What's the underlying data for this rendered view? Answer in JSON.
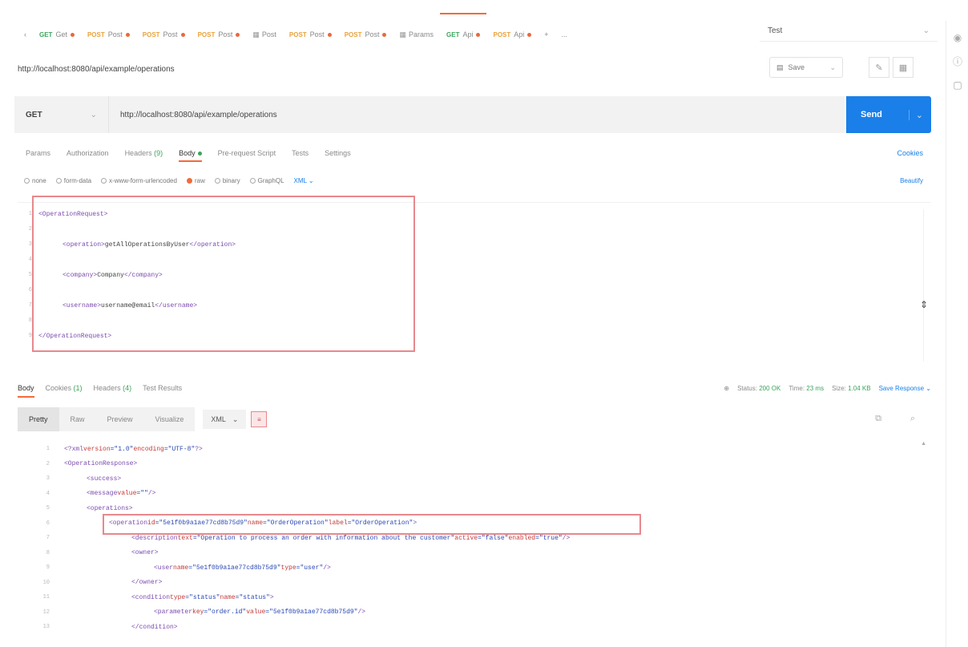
{
  "tabs": [
    {
      "method": "GET",
      "label": "Get",
      "modified": true
    },
    {
      "method": "POST",
      "label": "Post",
      "modified": true
    },
    {
      "method": "POST",
      "label": "Post",
      "modified": true
    },
    {
      "method": "POST",
      "label": "Post",
      "modified": true
    },
    {
      "method": "",
      "label": "Post",
      "modified": false,
      "icon": "grid"
    },
    {
      "method": "POST",
      "label": "Post",
      "modified": true
    },
    {
      "method": "POST",
      "label": "Post",
      "modified": true
    },
    {
      "method": "",
      "label": "Params",
      "modified": false,
      "icon": "grid"
    },
    {
      "method": "GET",
      "label": "Api",
      "modified": true,
      "active": true
    },
    {
      "method": "POST",
      "label": "Api",
      "modified": true
    }
  ],
  "tab_controls": [
    "+",
    "..."
  ],
  "environment": {
    "label": "Test"
  },
  "request": {
    "name": "http://localhost:8080/api/example/operations",
    "method": "GET",
    "url": "http://localhost:8080/api/example/operations",
    "save_label": "Save",
    "send_label": "Send"
  },
  "request_tabs": {
    "params": "Params",
    "authorization": "Authorization",
    "headers": "Headers",
    "headers_count": "(9)",
    "body": "Body",
    "prerequest": "Pre-request Script",
    "tests": "Tests",
    "settings": "Settings",
    "cookies": "Cookies"
  },
  "body_options": {
    "none": "none",
    "formdata": "form-data",
    "urlencoded": "x-www-form-urlencoded",
    "raw": "raw",
    "binary": "binary",
    "graphql": "GraphQL",
    "format": "XML",
    "beautify": "Beautify"
  },
  "request_body": [
    {
      "n": "1",
      "indent": 0,
      "parts": [
        {
          "c": "tag",
          "t": "<OperationRequest>"
        }
      ]
    },
    {
      "n": "2",
      "indent": 0,
      "parts": []
    },
    {
      "n": "3",
      "indent": 1,
      "parts": [
        {
          "c": "tag",
          "t": "<operation>"
        },
        {
          "c": "txt",
          "t": "getAllOperationsByUser"
        },
        {
          "c": "tag",
          "t": "</operation>"
        }
      ]
    },
    {
      "n": "4",
      "indent": 0,
      "parts": []
    },
    {
      "n": "5",
      "indent": 1,
      "parts": [
        {
          "c": "tag",
          "t": "<company>"
        },
        {
          "c": "txt",
          "t": "Company"
        },
        {
          "c": "tag",
          "t": "</company>"
        }
      ]
    },
    {
      "n": "6",
      "indent": 0,
      "parts": []
    },
    {
      "n": "7",
      "indent": 1,
      "parts": [
        {
          "c": "tag",
          "t": "<username>"
        },
        {
          "c": "txt",
          "t": "username@email"
        },
        {
          "c": "tag",
          "t": "</username>"
        }
      ]
    },
    {
      "n": "8",
      "indent": 0,
      "parts": []
    },
    {
      "n": "9",
      "indent": 0,
      "parts": [
        {
          "c": "tag",
          "t": "</OperationRequest>"
        }
      ]
    }
  ],
  "response_tabs": {
    "body": "Body",
    "cookies": "Cookies",
    "cookies_count": "(1)",
    "headers": "Headers",
    "headers_count": "(4)",
    "test_results": "Test Results",
    "status_label": "Status:",
    "status_value": "200 OK",
    "time_label": "Time:",
    "time_value": "23 ms",
    "size_label": "Size:",
    "size_value": "1.04 KB",
    "save_response": "Save Response"
  },
  "view": {
    "pretty": "Pretty",
    "raw": "Raw",
    "preview": "Preview",
    "visualize": "Visualize",
    "format": "XML"
  },
  "response_body": [
    {
      "n": "1",
      "indent": 0,
      "parts": [
        {
          "c": "tag",
          "t": "<?xml"
        },
        {
          "c": "attr",
          "t": " version"
        },
        {
          "c": "val",
          "t": "=\"1.0\""
        },
        {
          "c": "attr",
          "t": " encoding"
        },
        {
          "c": "val",
          "t": "=\"UTF-8\""
        },
        {
          "c": "tag",
          "t": "?>"
        }
      ]
    },
    {
      "n": "2",
      "indent": 0,
      "parts": [
        {
          "c": "tag",
          "t": "<OperationResponse>"
        }
      ]
    },
    {
      "n": "3",
      "indent": 1,
      "parts": [
        {
          "c": "tag",
          "t": "<success>"
        }
      ]
    },
    {
      "n": "4",
      "indent": 1,
      "parts": [
        {
          "c": "tag",
          "t": "<message"
        },
        {
          "c": "attr",
          "t": " value"
        },
        {
          "c": "val",
          "t": "=\"\""
        },
        {
          "c": "tag",
          "t": " />"
        }
      ]
    },
    {
      "n": "5",
      "indent": 1,
      "parts": [
        {
          "c": "tag",
          "t": "<operations>"
        }
      ]
    },
    {
      "n": "6",
      "indent": 2,
      "parts": [
        {
          "c": "tag",
          "t": "<operation"
        },
        {
          "c": "attr",
          "t": " id"
        },
        {
          "c": "val",
          "t": "=\"5e1f0b9a1ae77cd8b75d9\""
        },
        {
          "c": "attr",
          "t": " name"
        },
        {
          "c": "val",
          "t": "=\"OrderOperation\""
        },
        {
          "c": "attr",
          "t": " label"
        },
        {
          "c": "val",
          "t": "=\"OrderOperation\""
        },
        {
          "c": "tag",
          "t": ">"
        }
      ]
    },
    {
      "n": "7",
      "indent": 3,
      "parts": [
        {
          "c": "tag",
          "t": "<description"
        },
        {
          "c": "attr",
          "t": " text"
        },
        {
          "c": "val",
          "t": "=\"Operation to process an order with information about the customer\""
        },
        {
          "c": "attr",
          "t": " active"
        },
        {
          "c": "val",
          "t": "=\"false\""
        },
        {
          "c": "attr",
          "t": " enabled"
        },
        {
          "c": "val",
          "t": "=\"true\""
        },
        {
          "c": "tag",
          "t": " />"
        }
      ]
    },
    {
      "n": "8",
      "indent": 3,
      "parts": [
        {
          "c": "tag",
          "t": "<owner>"
        }
      ]
    },
    {
      "n": "9",
      "indent": 4,
      "parts": [
        {
          "c": "tag",
          "t": "<user"
        },
        {
          "c": "attr",
          "t": " name"
        },
        {
          "c": "val",
          "t": "=\"5e1f0b9a1ae77cd8b75d9\""
        },
        {
          "c": "attr",
          "t": " type"
        },
        {
          "c": "val",
          "t": "=\"user\""
        },
        {
          "c": "tag",
          "t": " />"
        }
      ]
    },
    {
      "n": "10",
      "indent": 3,
      "parts": [
        {
          "c": "tag",
          "t": "</owner>"
        }
      ]
    },
    {
      "n": "11",
      "indent": 3,
      "parts": [
        {
          "c": "tag",
          "t": "<condition"
        },
        {
          "c": "attr",
          "t": " type"
        },
        {
          "c": "val",
          "t": "=\"status\""
        },
        {
          "c": "attr",
          "t": " name"
        },
        {
          "c": "val",
          "t": "=\"status\""
        },
        {
          "c": "tag",
          "t": ">"
        }
      ]
    },
    {
      "n": "12",
      "indent": 4,
      "parts": [
        {
          "c": "tag",
          "t": "<parameter"
        },
        {
          "c": "attr",
          "t": " key"
        },
        {
          "c": "val",
          "t": "=\"order.id\""
        },
        {
          "c": "attr",
          "t": " value"
        },
        {
          "c": "val",
          "t": "=\"5e1f0b9a1ae77cd8b75d9\""
        },
        {
          "c": "tag",
          "t": " />"
        }
      ]
    },
    {
      "n": "13",
      "indent": 3,
      "parts": [
        {
          "c": "tag",
          "t": "</condition>"
        }
      ]
    }
  ]
}
